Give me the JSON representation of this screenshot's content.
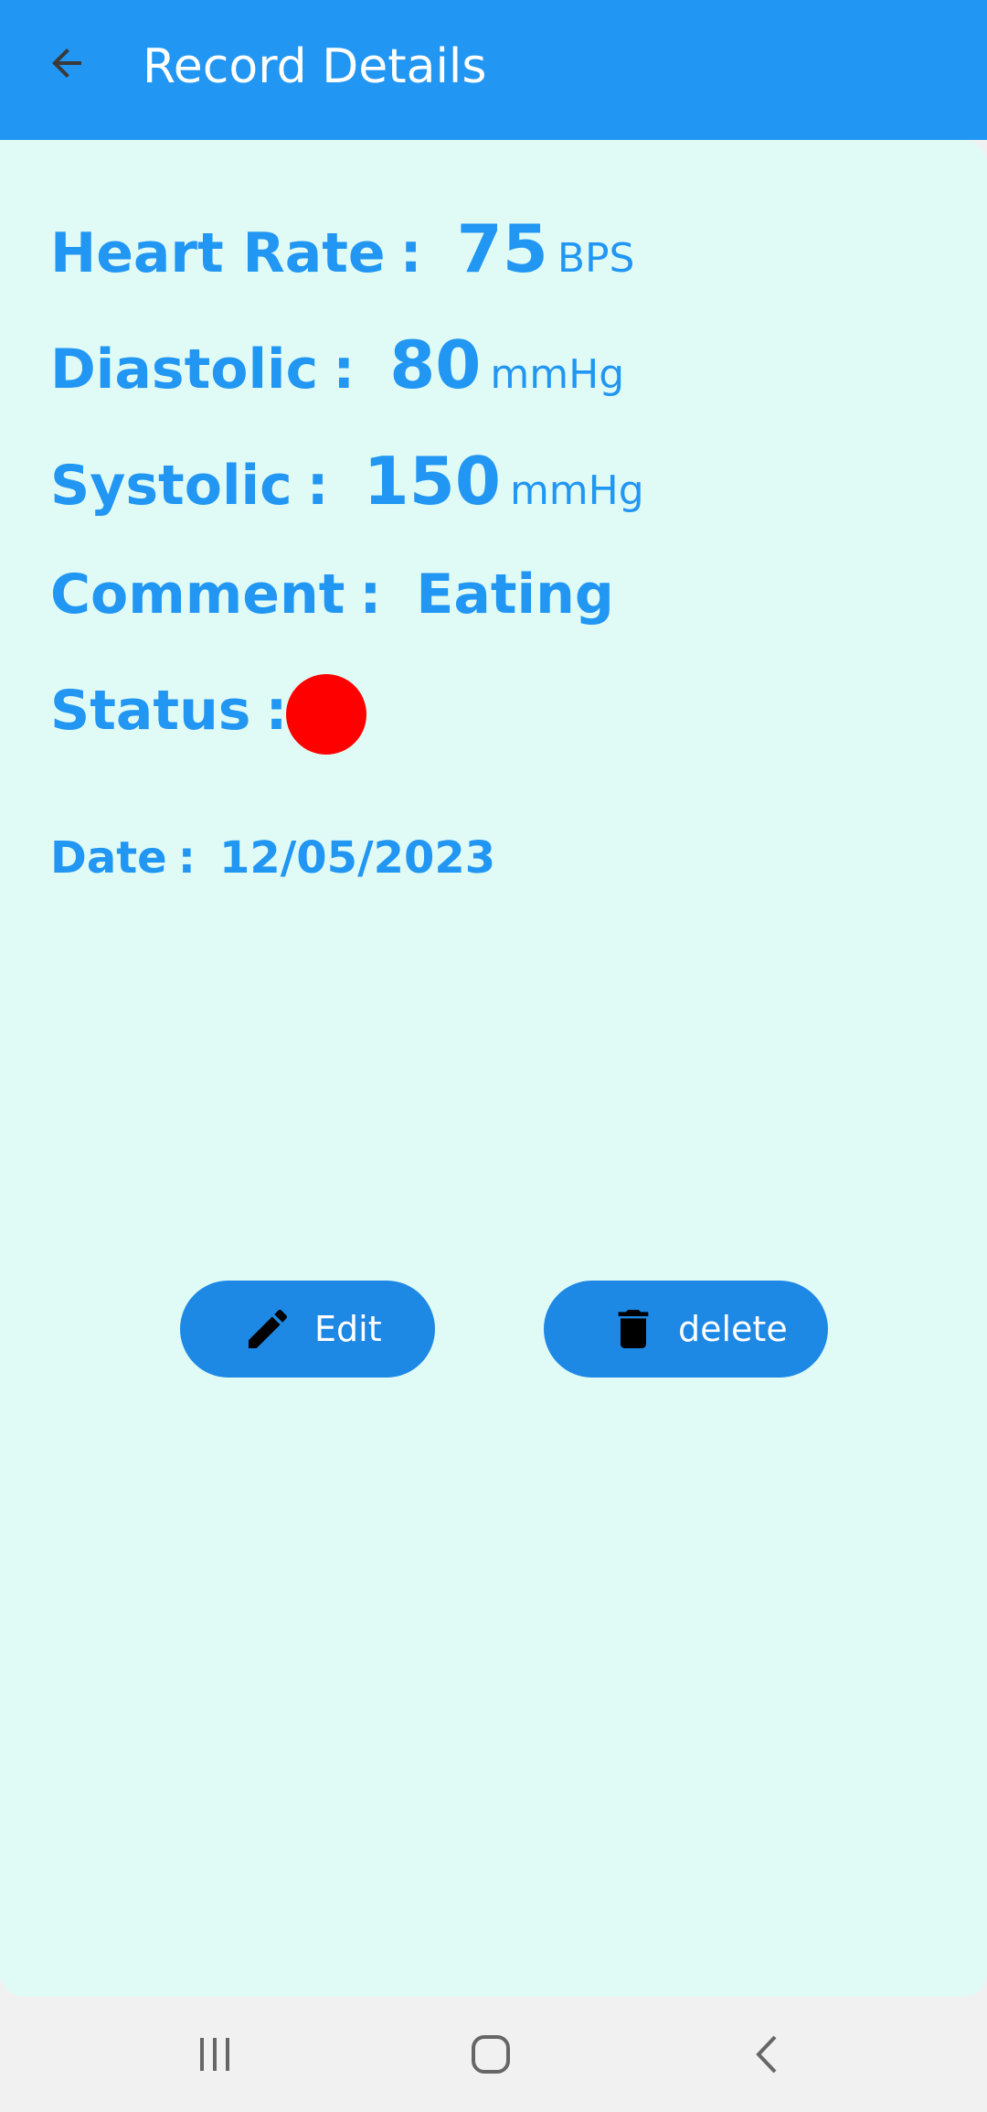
{
  "appbar": {
    "title": "Record Details",
    "back_icon": "arrow-left-icon",
    "color": "#2196f3"
  },
  "details": {
    "heart_rate": {
      "label": "Heart Rate",
      "colon": ":",
      "value": "75",
      "unit": "BPS"
    },
    "diastolic": {
      "label": "Diastolic",
      "colon": ":",
      "value": "80",
      "unit": "mmHg"
    },
    "systolic": {
      "label": "Systolic",
      "colon": ":",
      "value": "150",
      "unit": "mmHg"
    },
    "comment": {
      "label": "Comment",
      "colon": ":",
      "value": "Eating"
    },
    "status": {
      "label": "Status",
      "colon": ":",
      "indicator_color": "#fe0000"
    },
    "date": {
      "label": "Date",
      "colon": ":",
      "value": "12/05/2023"
    }
  },
  "actions": {
    "edit": {
      "label": "Edit",
      "icon": "pencil-icon"
    },
    "delete": {
      "label": "delete",
      "icon": "trash-icon"
    }
  },
  "navbar": {
    "recents_icon": "recents-icon",
    "home_icon": "home-icon",
    "back_icon": "back-chevron-icon"
  }
}
